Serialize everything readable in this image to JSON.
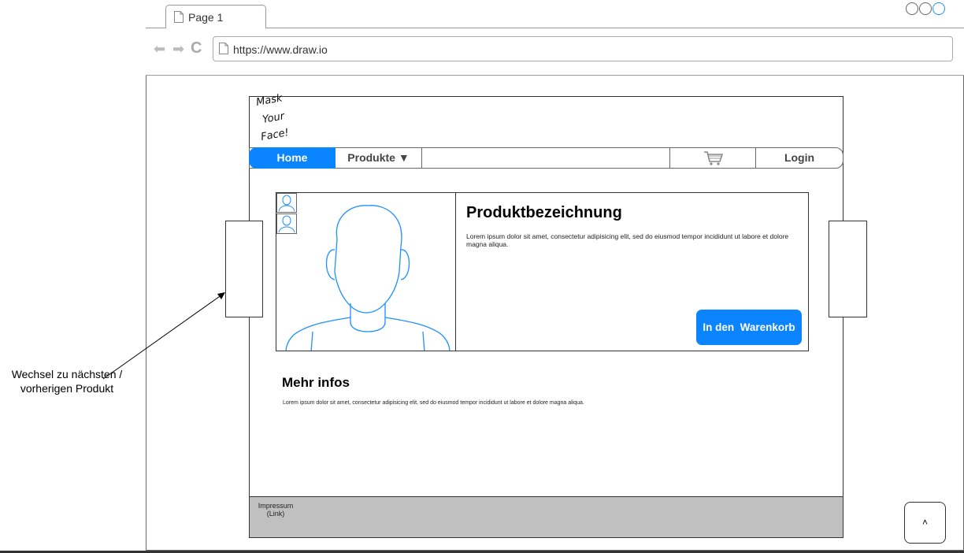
{
  "browser": {
    "tab_label": "Page 1",
    "url": "https://www.draw.io",
    "back_glyph": "⬅",
    "forward_glyph": "➡",
    "reload_glyph": "C"
  },
  "site": {
    "logo_lines": [
      "Mask",
      "Your",
      "Face!"
    ],
    "nav": {
      "home": "Home",
      "products": "Produkte ▼",
      "cart_icon": "shopping-cart-icon",
      "login": "Login"
    },
    "product": {
      "title": "Produktbezeichnung",
      "description": "Lorem ipsum dolor sit amet, consectetur adipisicing elit, sed do eiusmod tempor incididunt ut labore et dolore magna aliqua.",
      "cart_button": "In den  Warenkorb"
    },
    "more_info": {
      "title": "Mehr infos",
      "text": "Lorem ipsum dolor sit amet, consectetur adipisicing elit, sed do eiusmod tempor incididunt ut labore et dolore magna aliqua."
    },
    "footer": {
      "link": "Impressum (Link)"
    },
    "scroll_top": "˄"
  },
  "annotation": {
    "text": "Wechsel zu nächsten / vorherigen Produkt"
  },
  "colors": {
    "accent": "#0a84ff",
    "footer": "#c0c0c0",
    "avatar_stroke": "#1e90ff"
  }
}
